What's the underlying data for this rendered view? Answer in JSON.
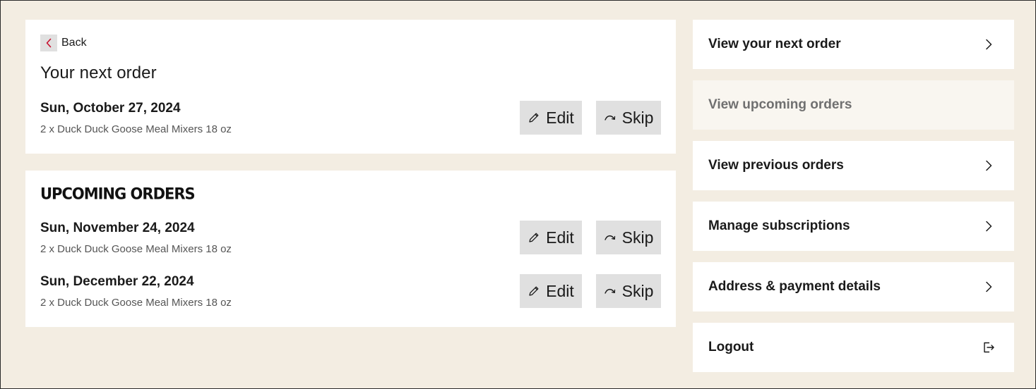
{
  "back": {
    "label": "Back"
  },
  "next_order": {
    "title": "Your next order",
    "order": {
      "date": "Sun, October 27, 2024",
      "items": "2 x Duck Duck Goose Meal Mixers 18 oz",
      "edit_label": "Edit",
      "skip_label": "Skip"
    }
  },
  "upcoming": {
    "title": "Upcoming Orders",
    "orders": [
      {
        "date": "Sun, November 24, 2024",
        "items": "2 x Duck Duck Goose Meal Mixers 18 oz",
        "edit_label": "Edit",
        "skip_label": "Skip"
      },
      {
        "date": "Sun, December 22, 2024",
        "items": "2 x Duck Duck Goose Meal Mixers 18 oz",
        "edit_label": "Edit",
        "skip_label": "Skip"
      }
    ]
  },
  "sidebar": {
    "items": [
      {
        "label": "View your next order",
        "icon": "chevron-right-icon",
        "active": false
      },
      {
        "label": "View upcoming orders",
        "icon": "",
        "active": true
      },
      {
        "label": "View previous orders",
        "icon": "chevron-right-icon",
        "active": false
      },
      {
        "label": "Manage subscriptions",
        "icon": "chevron-right-icon",
        "active": false
      },
      {
        "label": "Address & payment details",
        "icon": "chevron-right-icon",
        "active": false
      },
      {
        "label": "Logout",
        "icon": "logout-icon",
        "active": false
      }
    ]
  },
  "colors": {
    "page_background": "#f3ede2",
    "card_background": "#ffffff",
    "button_background": "#e0e0e0",
    "back_chevron": "#c8102e",
    "active_nav_background": "#f9f6f0",
    "active_nav_text": "#707070"
  }
}
